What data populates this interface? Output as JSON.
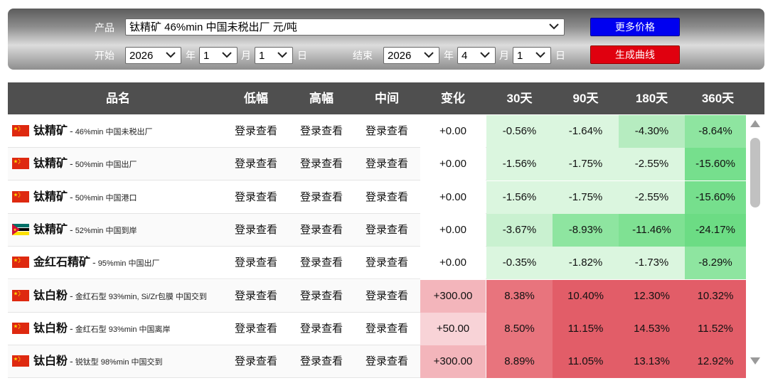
{
  "controls": {
    "product_label": "产品",
    "product_value": "钛精矿  46%min 中国未税出厂 元/吨",
    "start_label": "开始",
    "end_label": "结束",
    "year_unit": "年",
    "month_unit": "月",
    "day_unit": "日",
    "start_year": "2026",
    "start_month": "1",
    "start_day": "1",
    "end_year": "2026",
    "end_month": "4",
    "end_day": "1",
    "more_price_button": "更多价格",
    "generate_curve_button": "生成曲线"
  },
  "table": {
    "headers": [
      "品名",
      "低幅",
      "高幅",
      "中间",
      "变化",
      "30天",
      "90天",
      "180天",
      "360天"
    ],
    "rows": [
      {
        "flag": "china",
        "name": "钛精矿",
        "dash": "-",
        "spec": "46%min 中国未税出厂",
        "low": "登录查看",
        "high": "登录查看",
        "mid": "登录查看",
        "change": "+0.00",
        "d30": "-0.56%",
        "d90": "-1.64%",
        "d180": "-4.30%",
        "d360": "-8.64%",
        "colors": {
          "change": "#ffffff",
          "d30": "#dbf6df",
          "d90": "#dbf6df",
          "d180": "#b6ecc0",
          "d360": "#8ee5a0"
        }
      },
      {
        "flag": "china",
        "name": "钛精矿",
        "dash": "-",
        "spec": "50%min 中国出厂",
        "low": "登录查看",
        "high": "登录查看",
        "mid": "登录查看",
        "change": "+0.00",
        "d30": "-1.56%",
        "d90": "-1.75%",
        "d180": "-2.55%",
        "d360": "-15.60%",
        "colors": {
          "change": "#ffffff",
          "d30": "#dbf6df",
          "d90": "#dbf6df",
          "d180": "#dbf6df",
          "d360": "#76df8d"
        }
      },
      {
        "flag": "china",
        "name": "钛精矿",
        "dash": "-",
        "spec": "50%min 中国港口",
        "low": "登录查看",
        "high": "登录查看",
        "mid": "登录查看",
        "change": "+0.00",
        "d30": "-1.56%",
        "d90": "-1.75%",
        "d180": "-2.55%",
        "d360": "-15.60%",
        "colors": {
          "change": "#ffffff",
          "d30": "#dbf6df",
          "d90": "#dbf6df",
          "d180": "#dbf6df",
          "d360": "#76df8d"
        }
      },
      {
        "flag": "mozambique",
        "name": "钛精矿",
        "dash": "-",
        "spec": "52%min 中国到岸",
        "low": "登录查看",
        "high": "登录查看",
        "mid": "登录查看",
        "change": "+0.00",
        "d30": "-3.67%",
        "d90": "-8.93%",
        "d180": "-11.46%",
        "d360": "-24.17%",
        "colors": {
          "change": "#ffffff",
          "d30": "#c9f1d0",
          "d90": "#8ee5a0",
          "d180": "#7fe193",
          "d360": "#6cdc84"
        }
      },
      {
        "flag": "china",
        "name": "金红石精矿",
        "dash": "-",
        "spec": "95%min 中国出厂",
        "low": "登录查看",
        "high": "登录查看",
        "mid": "登录查看",
        "change": "+0.00",
        "d30": "-0.35%",
        "d90": "-1.82%",
        "d180": "-1.73%",
        "d360": "-8.29%",
        "colors": {
          "change": "#ffffff",
          "d30": "#dbf6df",
          "d90": "#dbf6df",
          "d180": "#dbf6df",
          "d360": "#8ee5a0"
        }
      },
      {
        "flag": "china",
        "name": "钛白粉",
        "dash": "-",
        "spec": "金红石型 93%min, Si/Zr包膜 中国交到",
        "low": "登录查看",
        "high": "登录查看",
        "mid": "登录查看",
        "change": "+300.00",
        "d30": "8.38%",
        "d90": "10.40%",
        "d180": "12.30%",
        "d360": "10.32%",
        "colors": {
          "change": "#f3b5bb",
          "d30": "#e8747d",
          "d90": "#e25d68",
          "d180": "#e25d68",
          "d360": "#e25d68"
        }
      },
      {
        "flag": "china",
        "name": "钛白粉",
        "dash": "-",
        "spec": "金红石型 93%min 中国离岸",
        "low": "登录查看",
        "high": "登录查看",
        "mid": "登录查看",
        "change": "+50.00",
        "d30": "8.50%",
        "d90": "11.15%",
        "d180": "14.53%",
        "d360": "11.52%",
        "colors": {
          "change": "#f8d3d7",
          "d30": "#e8747d",
          "d90": "#e25d68",
          "d180": "#e25d68",
          "d360": "#e25d68"
        }
      },
      {
        "flag": "china",
        "name": "钛白粉",
        "dash": "-",
        "spec": "锐钛型 98%min 中国交到",
        "low": "登录查看",
        "high": "登录查看",
        "mid": "登录查看",
        "change": "+300.00",
        "d30": "8.89%",
        "d90": "11.05%",
        "d180": "13.13%",
        "d360": "12.92%",
        "colors": {
          "change": "#f3b5bb",
          "d30": "#e8747d",
          "d90": "#e25d68",
          "d180": "#e25d68",
          "d360": "#e25d68"
        }
      }
    ]
  }
}
